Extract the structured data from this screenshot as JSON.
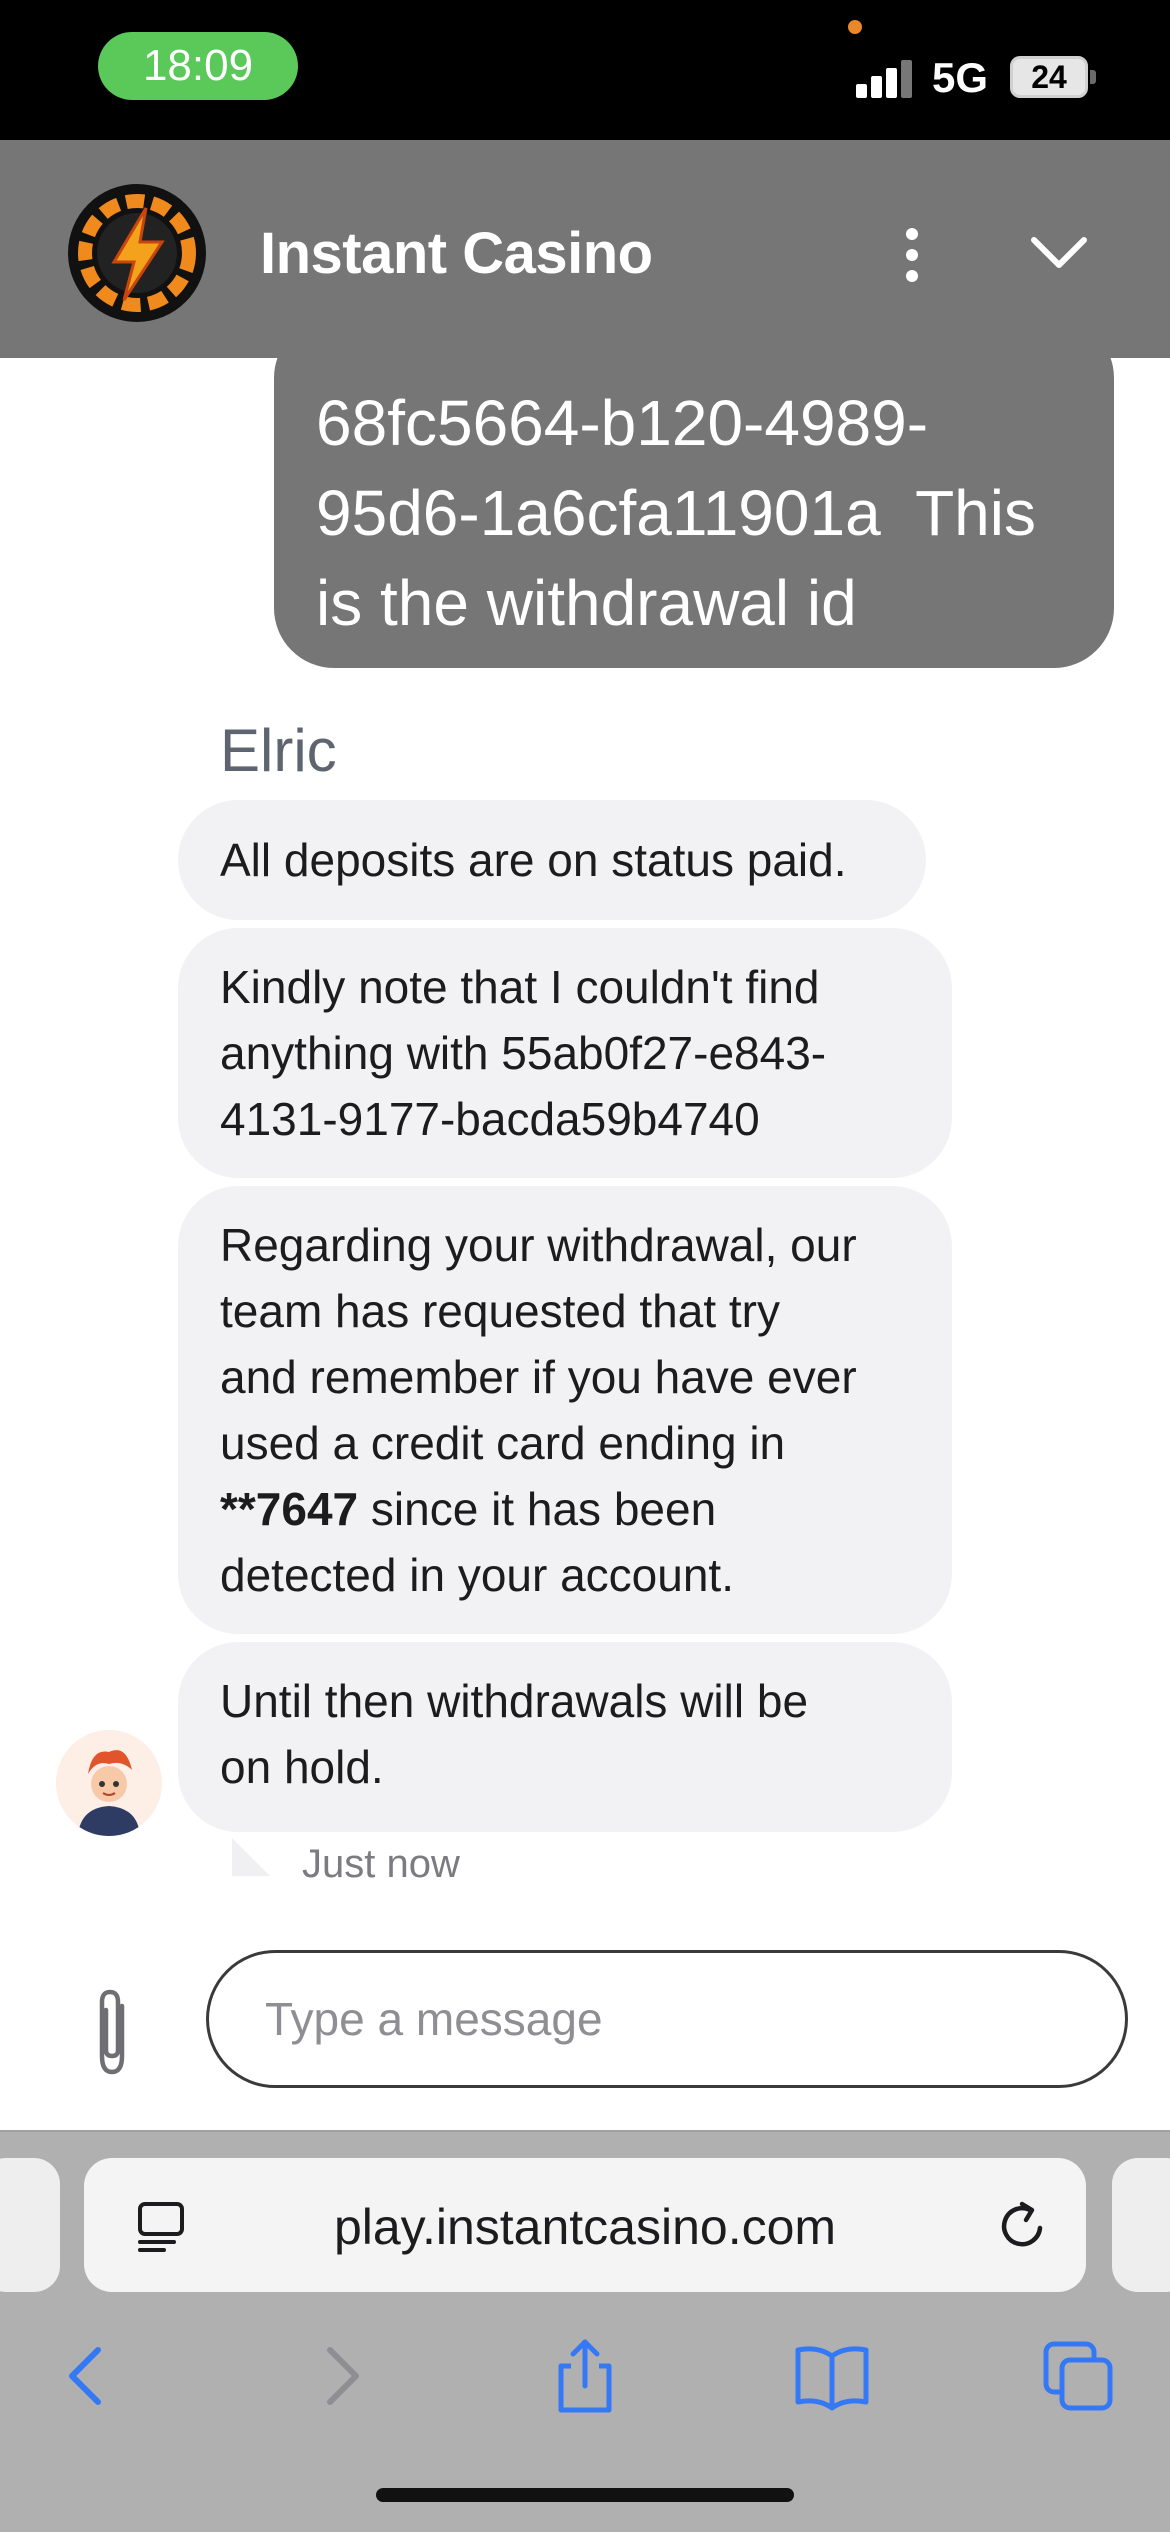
{
  "status_bar": {
    "time": "18:09",
    "network": "5G",
    "battery": "24"
  },
  "header": {
    "title": "Instant Casino",
    "logo_icon": "lightning-bolt-chip-logo",
    "menu_icon": "more-vertical-icon",
    "collapse_icon": "chevron-down-icon"
  },
  "colors": {
    "header_bg": "#767676",
    "user_bubble": "#767676",
    "agent_bubble": "#f2f2f4",
    "accent_blue": "#3478f6"
  },
  "messages": {
    "user": {
      "line1": "68fc5664-b120-4989-",
      "line2": "95d6-1a6cfa11901a  This",
      "line3": "is the withdrawal id"
    },
    "agent_name": "Elric",
    "agent": {
      "m1": "All deposits are on status paid.",
      "m2_line1": "Kindly note that I couldn't find",
      "m2_line2": "anything with 55ab0f27-e843-",
      "m2_line3": "4131-9177-bacda59b4740",
      "m3_line1": "Regarding your withdrawal, our",
      "m3_line2": "team has requested that try",
      "m3_line3": "and remember if you have ever",
      "m3_line4": "used a credit card ending in",
      "m3_bold": "**7647",
      "m3_line5_rest": " since it has been",
      "m3_line6": "detected in your account.",
      "m4_line1": "Until then withdrawals will be",
      "m4_line2": "on hold."
    },
    "timestamp": "Just now"
  },
  "composer": {
    "placeholder": "Type a message",
    "value": "",
    "attach_icon": "paperclip-icon"
  },
  "browser": {
    "url": "play.instantcasino.com",
    "icons": [
      "reader-mode-icon",
      "reload-icon",
      "back-icon",
      "forward-icon",
      "share-icon",
      "bookmarks-icon",
      "tabs-icon"
    ]
  }
}
